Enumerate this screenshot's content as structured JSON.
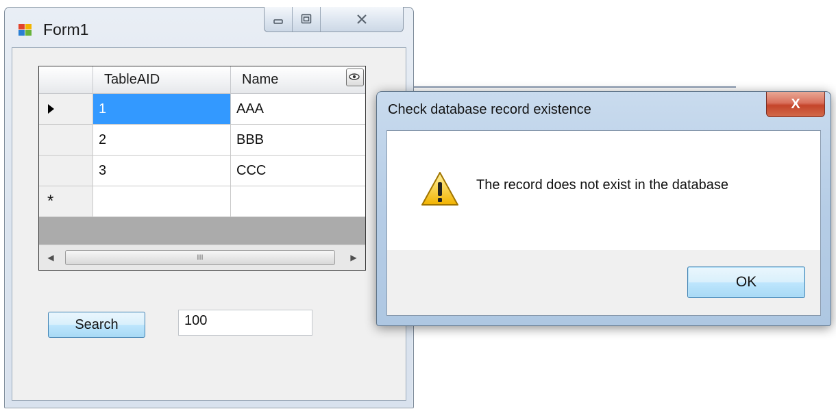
{
  "form1": {
    "title": "Form1",
    "window_controls": {
      "minimize": "—",
      "maximize": "▫",
      "close": "✕"
    },
    "grid": {
      "columns": [
        "TableAID",
        "Name"
      ],
      "rows": [
        {
          "marker": "current",
          "cells": [
            "1",
            "AAA"
          ]
        },
        {
          "marker": "",
          "cells": [
            "2",
            "BBB"
          ]
        },
        {
          "marker": "",
          "cells": [
            "3",
            "CCC"
          ]
        },
        {
          "marker": "new",
          "cells": [
            "",
            ""
          ]
        }
      ],
      "new_row_marker": "*",
      "scrollbar_grip": "III",
      "scroll_left_arrow": "◀",
      "scroll_right_arrow": "▶"
    },
    "search_button_label": "Search",
    "search_input_value": "100"
  },
  "message_box": {
    "title": "Check database record existence",
    "close_label": "X",
    "icon": "warning-icon",
    "message": "The record does not exist in the database",
    "ok_label": "OK"
  },
  "colors": {
    "selection": "#3399ff",
    "button_border": "#3c7fb1",
    "close_button": "#c4442a",
    "warning_yellow": "#f7c500"
  }
}
